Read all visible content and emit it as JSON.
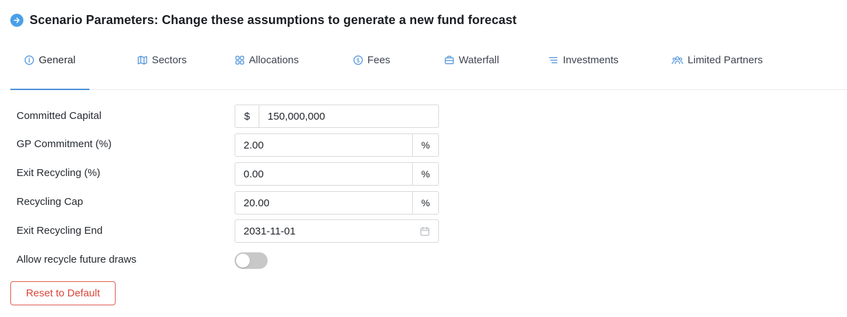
{
  "header": {
    "title": "Scenario Parameters: Change these assumptions to generate a new fund forecast",
    "icon": "arrow-right-circle-icon",
    "accent": "#4a9fe8"
  },
  "tabs": [
    {
      "label": "General",
      "icon": "info-icon",
      "active": true
    },
    {
      "label": "Sectors",
      "icon": "map-icon",
      "active": false
    },
    {
      "label": "Allocations",
      "icon": "grid-icon",
      "active": false
    },
    {
      "label": "Fees",
      "icon": "dollar-circle-icon",
      "active": false
    },
    {
      "label": "Waterfall",
      "icon": "briefcase-icon",
      "active": false
    },
    {
      "label": "Investments",
      "icon": "list-icon",
      "active": false
    },
    {
      "label": "Limited Partners",
      "icon": "users-icon",
      "active": false
    }
  ],
  "form": {
    "committed_capital": {
      "label": "Committed Capital",
      "prefix": "$",
      "value": "150,000,000"
    },
    "gp_commitment": {
      "label": "GP Commitment (%)",
      "value": "2.00",
      "suffix": "%"
    },
    "exit_recycling": {
      "label": "Exit Recycling (%)",
      "value": "0.00",
      "suffix": "%"
    },
    "recycling_cap": {
      "label": "Recycling Cap",
      "value": "20.00",
      "suffix": "%"
    },
    "exit_recycling_end": {
      "label": "Exit Recycling End",
      "value": "2031-11-01",
      "icon": "calendar-icon"
    },
    "allow_recycle": {
      "label": "Allow recycle future draws",
      "enabled": false
    }
  },
  "actions": {
    "reset_label": "Reset to Default",
    "reset_color": "#d9473a"
  }
}
